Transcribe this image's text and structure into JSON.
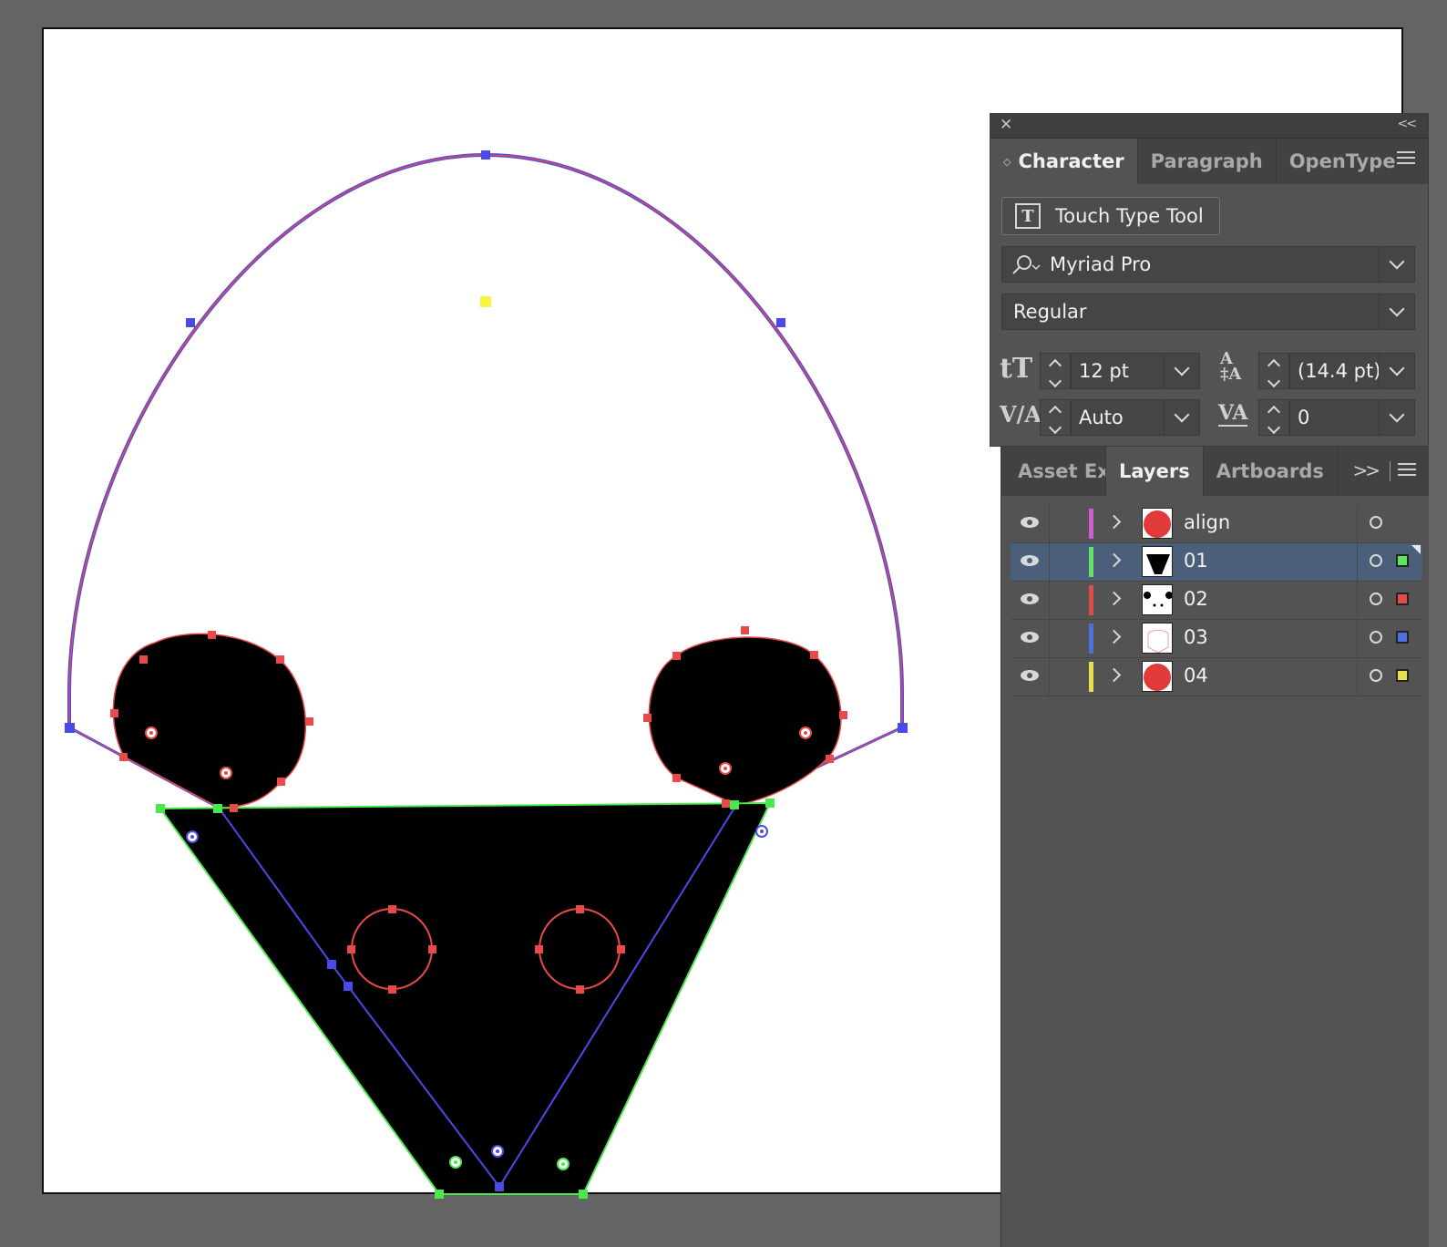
{
  "character_panel": {
    "tabs": [
      "Character",
      "Paragraph",
      "OpenType"
    ],
    "touch_type_label": "Touch Type Tool",
    "font_family": "Myriad Pro",
    "font_style": "Regular",
    "font_size": "12 pt",
    "leading": "(14.4 pt)",
    "kerning": "Auto",
    "tracking": "0"
  },
  "layers_panel": {
    "tabs": [
      "Asset Expo",
      "Layers",
      "Artboards"
    ],
    "layers": [
      {
        "name": "align",
        "color": "#d35bd3",
        "selected": false,
        "has_selection": false,
        "sel_color": ""
      },
      {
        "name": "01",
        "color": "#5fe45f",
        "selected": true,
        "has_selection": true,
        "sel_color": "#5fe45f"
      },
      {
        "name": "02",
        "color": "#e04b4b",
        "selected": false,
        "has_selection": true,
        "sel_color": "#e04b4b"
      },
      {
        "name": "03",
        "color": "#4f6fe0",
        "selected": false,
        "has_selection": true,
        "sel_color": "#4f6fe0"
      },
      {
        "name": "04",
        "color": "#e8e04b",
        "selected": false,
        "has_selection": true,
        "sel_color": "#e8e04b"
      }
    ]
  },
  "colors": {
    "blue_path": "#4a4ae8",
    "red_path": "#e84a4a",
    "green_path": "#4ae84a",
    "center_marker": "#f5f542"
  }
}
